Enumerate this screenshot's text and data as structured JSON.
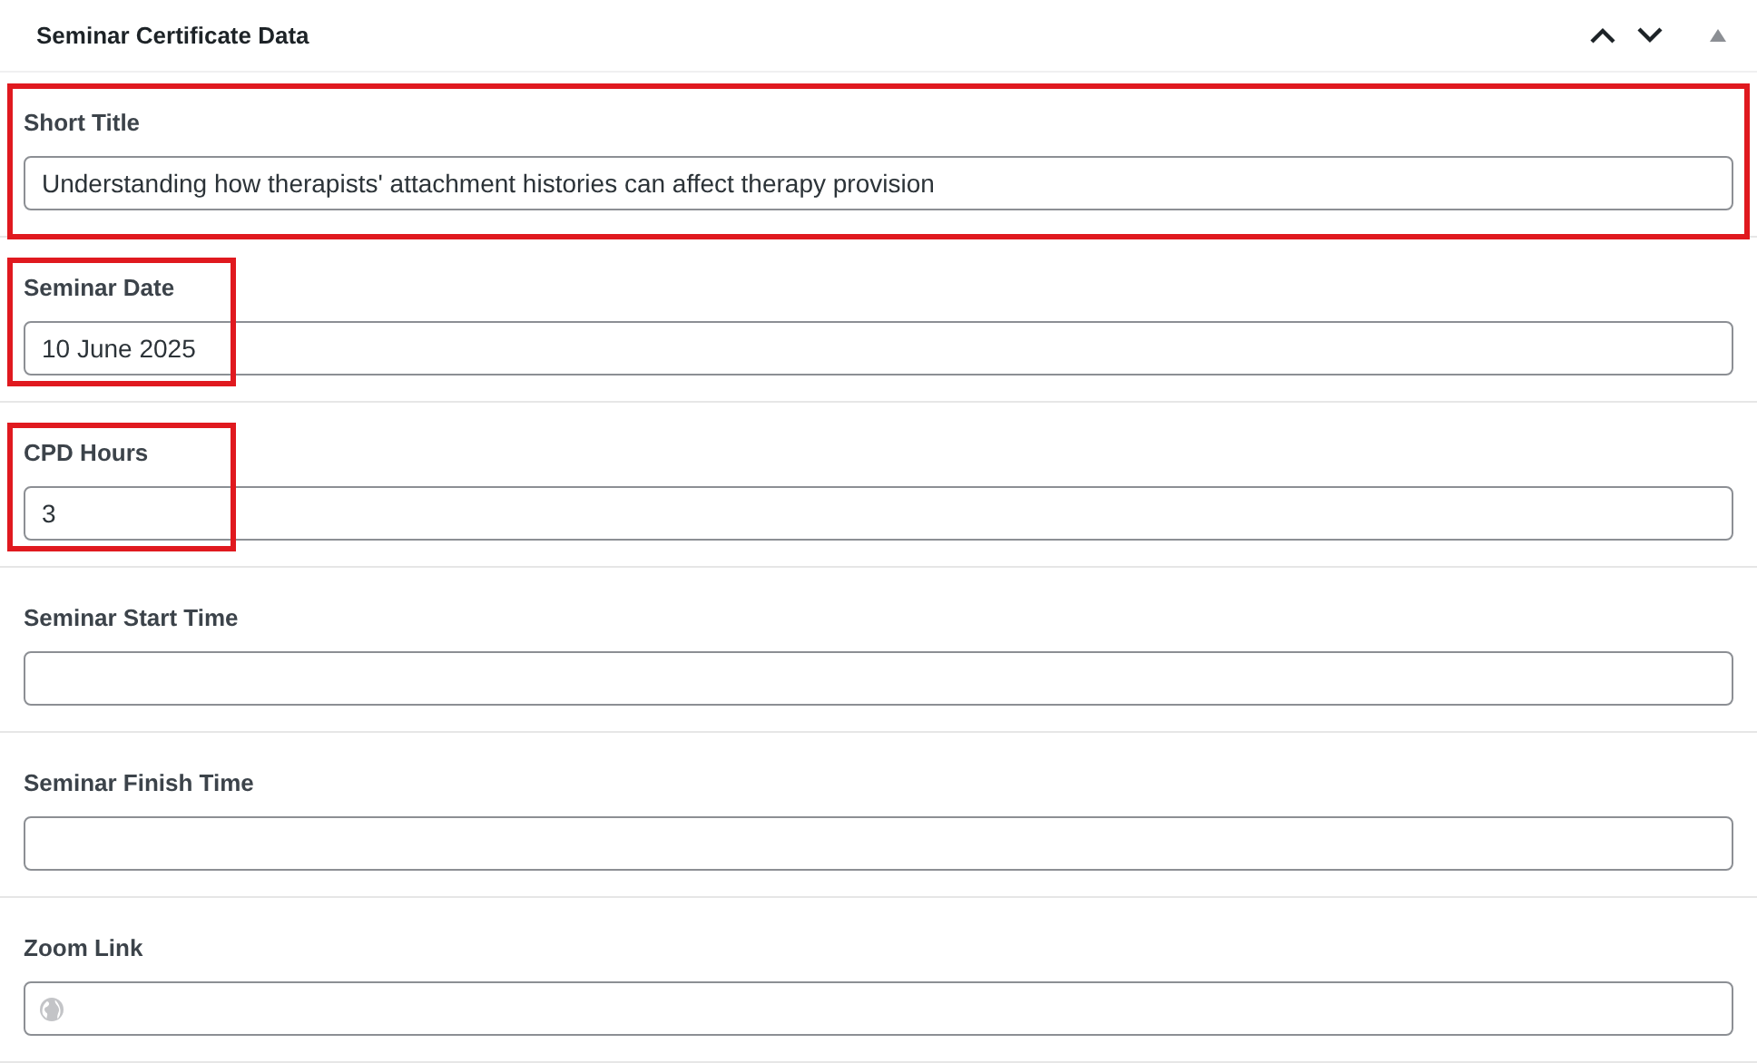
{
  "panel": {
    "title": "Seminar Certificate Data",
    "expanded": true
  },
  "fields": [
    {
      "label": "Short Title",
      "value": "Understanding how therapists' attachment histories can affect therapy provision",
      "highlighted": true,
      "highlight_full_width": true,
      "kind": "text"
    },
    {
      "label": "Seminar Date",
      "value": "10 June 2025",
      "highlighted": true,
      "highlight_full_width": false,
      "kind": "text"
    },
    {
      "label": "CPD Hours",
      "value": "3",
      "highlighted": true,
      "highlight_full_width": false,
      "kind": "text"
    },
    {
      "label": "Seminar Start Time",
      "highlighted": false,
      "kind": "text"
    },
    {
      "label": "Seminar Finish Time",
      "highlighted": false,
      "kind": "text"
    },
    {
      "label": "Zoom Link",
      "highlighted": false,
      "kind": "url"
    }
  ]
}
